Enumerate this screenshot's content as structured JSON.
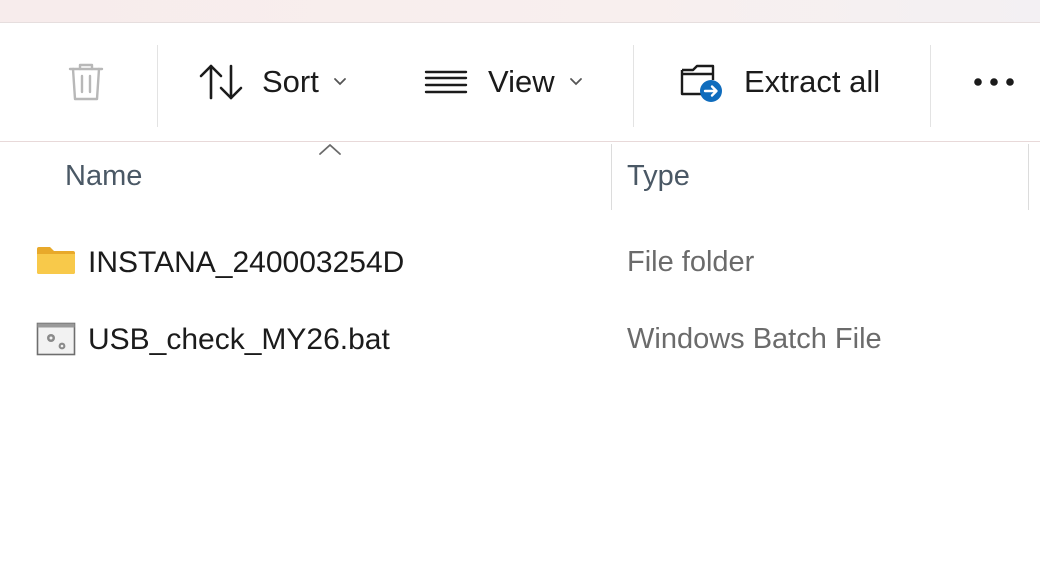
{
  "toolbar": {
    "delete_icon": "trash-icon",
    "sort_label": "Sort",
    "sort_icon": "sort-arrows-icon",
    "view_label": "View",
    "view_icon": "list-lines-icon",
    "extract_label": "Extract all",
    "extract_icon": "folder-extract-icon",
    "more_icon": "ellipsis-icon"
  },
  "columns": {
    "name": "Name",
    "type": "Type",
    "sorted_by": "Name"
  },
  "files": [
    {
      "name": "INSTANA_240003254D",
      "type": "File folder",
      "icon": "folder-icon"
    },
    {
      "name": "USB_check_MY26.bat",
      "type": "Windows Batch File",
      "icon": "batch-file-icon"
    }
  ],
  "colors": {
    "folder": "#F4C242",
    "accent": "#0F6CBD",
    "text": "#1B1B1B",
    "muted_text": "#6B6B6B"
  }
}
